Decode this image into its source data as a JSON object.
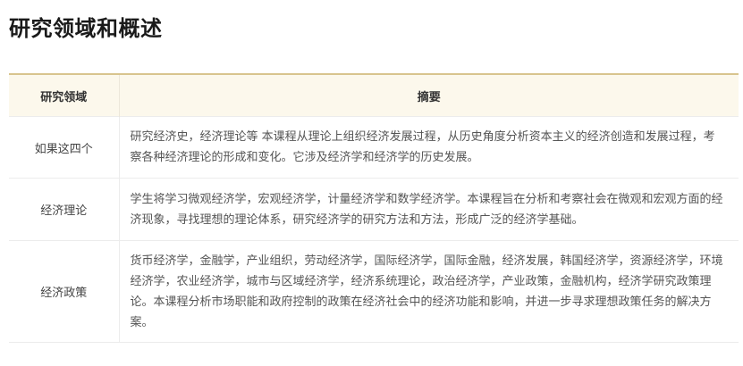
{
  "page": {
    "title": "研究领域和概述"
  },
  "table": {
    "headers": {
      "field": "研究领域",
      "summary": "摘要"
    },
    "rows": [
      {
        "field": "如果这四个",
        "summary": "研究经济史，经济理论等 本课程从理论上组织经济发展过程，从历史角度分析资本主义的经济创造和发展过程，考察各种经济理论的形成和变化。它涉及经济学和经济学的历史发展。"
      },
      {
        "field": "经济理论",
        "summary": "学生将学习微观经济学，宏观经济学，计量经济学和数学经济学。本课程旨在分析和考察社会在微观和宏观方面的经济现象，寻找理想的理论体系，研究经济学的研究方法和方法，形成广泛的经济学基础。"
      },
      {
        "field": "经济政策",
        "summary": "货币经济学，金融学，产业组织，劳动经济学，国际经济学，国际金融，经济发展，韩国经济学，资源经济学，环境经济学，农业经济学，城市与区域经济学，经济系统理论，政治经济学，产业政策，金融机构，经济学研究政策理论。本课程分析市场职能和政府控制的政策在经济社会中的经济功能和影响，并进一步寻求理想政策任务的解决方案。"
      }
    ]
  }
}
